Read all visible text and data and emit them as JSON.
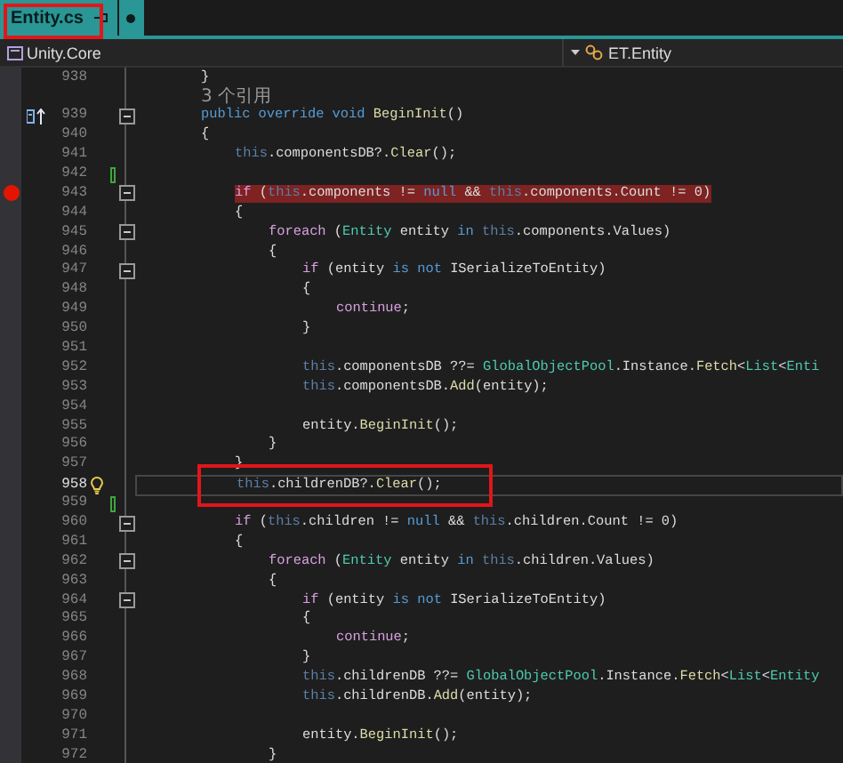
{
  "tab": {
    "title": "Entity.cs",
    "selected": true,
    "outlined": true,
    "modified": true
  },
  "nav": {
    "project": "Unity.Core",
    "member": "ET.Entity"
  },
  "lines": [
    {
      "kind": "code",
      "number": "938",
      "segments": [
        {
          "kind": "plain",
          "text": "}"
        }
      ]
    },
    {
      "kind": "codelens",
      "text": "3 个引用"
    },
    {
      "kind": "code",
      "number": "939",
      "override_marker": true,
      "expanded": true,
      "segments": [
        {
          "kind": "keyword",
          "text": "public override void "
        },
        {
          "kind": "method",
          "text": "BeginInit"
        },
        {
          "kind": "plain",
          "text": "()"
        }
      ]
    },
    {
      "kind": "code",
      "number": "940",
      "segments": [
        {
          "kind": "plain",
          "text": "{"
        }
      ],
      "children": [
        {
          "kind": "code",
          "number": "941",
          "segments": [
            {
              "kind": "faded",
              "text": "this"
            },
            {
              "kind": "plain",
              "text": ".componentsDB?."
            },
            {
              "kind": "method",
              "text": "Clear"
            },
            {
              "kind": "plain",
              "text": "();"
            }
          ]
        },
        {
          "kind": "code",
          "number": "942",
          "changed": true
        },
        {
          "kind": "code",
          "number": "943",
          "breakpoint": true,
          "expanded": true,
          "segments": [
            {
              "kind": "control",
              "text": "if"
            },
            {
              "kind": "plain",
              "text": " ("
            },
            {
              "kind": "faded",
              "text": "this"
            },
            {
              "kind": "plain",
              "text": ".components != "
            },
            {
              "kind": "keyword",
              "text": "null"
            },
            {
              "kind": "plain",
              "text": " && "
            },
            {
              "kind": "faded",
              "text": "this"
            },
            {
              "kind": "plain",
              "text": ".components.Count != 0)"
            }
          ]
        },
        {
          "kind": "code",
          "number": "944",
          "segments": [
            {
              "kind": "plain",
              "text": "{"
            }
          ],
          "children": [
            {
              "kind": "code",
              "number": "945",
              "expanded": true,
              "segments": [
                {
                  "kind": "control",
                  "text": "foreach"
                },
                {
                  "kind": "plain",
                  "text": " ("
                },
                {
                  "kind": "type",
                  "text": "Entity"
                },
                {
                  "kind": "plain",
                  "text": " entity "
                },
                {
                  "kind": "keyword",
                  "text": "in "
                },
                {
                  "kind": "faded",
                  "text": "this"
                },
                {
                  "kind": "plain",
                  "text": ".components.Values)"
                }
              ]
            },
            {
              "kind": "code",
              "number": "946",
              "segments": [
                {
                  "kind": "plain",
                  "text": "{"
                }
              ],
              "children": [
                {
                  "kind": "code",
                  "number": "947",
                  "expanded": true,
                  "segments": [
                    {
                      "kind": "control",
                      "text": "if"
                    },
                    {
                      "kind": "plain",
                      "text": " (entity "
                    },
                    {
                      "kind": "keyword",
                      "text": "is not"
                    },
                    {
                      "kind": "plain",
                      "text": " ISerializeToEntity)"
                    }
                  ]
                },
                {
                  "kind": "code",
                  "number": "948",
                  "segments": [
                    {
                      "kind": "plain",
                      "text": "{"
                    }
                  ],
                  "children": [
                    {
                      "kind": "code",
                      "number": "949",
                      "segments": [
                        {
                          "kind": "control",
                          "text": "continue"
                        },
                        {
                          "kind": "plain",
                          "text": ";"
                        }
                      ]
                    }
                  ]
                },
                {
                  "kind": "code",
                  "number": "950",
                  "segments": [
                    {
                      "kind": "plain",
                      "text": "}"
                    }
                  ]
                },
                {
                  "kind": "code",
                  "number": "951"
                },
                {
                  "kind": "code",
                  "number": "952",
                  "segments": [
                    {
                      "kind": "faded",
                      "text": "this"
                    },
                    {
                      "kind": "plain",
                      "text": ".componentsDB ??= "
                    },
                    {
                      "kind": "type",
                      "text": "GlobalObjectPool"
                    },
                    {
                      "kind": "plain",
                      "text": ".Instance."
                    },
                    {
                      "kind": "method",
                      "text": "Fetch"
                    },
                    {
                      "kind": "plain",
                      "text": "<"
                    },
                    {
                      "kind": "type",
                      "text": "List"
                    },
                    {
                      "kind": "plain",
                      "text": "<"
                    },
                    {
                      "kind": "type",
                      "text": "Enti"
                    }
                  ]
                },
                {
                  "kind": "code",
                  "number": "953",
                  "segments": [
                    {
                      "kind": "faded",
                      "text": "this"
                    },
                    {
                      "kind": "plain",
                      "text": ".componentsDB."
                    },
                    {
                      "kind": "method",
                      "text": "Add"
                    },
                    {
                      "kind": "plain",
                      "text": "(entity);"
                    }
                  ]
                },
                {
                  "kind": "code",
                  "number": "954"
                },
                {
                  "kind": "code",
                  "number": "955",
                  "segments": [
                    {
                      "kind": "plain",
                      "text": "entity."
                    },
                    {
                      "kind": "method",
                      "text": "BeginInit"
                    },
                    {
                      "kind": "plain",
                      "text": "();"
                    }
                  ]
                }
              ]
            },
            {
              "kind": "code",
              "number": "956",
              "segments": [
                {
                  "kind": "plain",
                  "text": "}"
                }
              ]
            }
          ]
        },
        {
          "kind": "code",
          "number": "957",
          "segments": [
            {
              "kind": "plain",
              "text": "}"
            }
          ]
        },
        {
          "kind": "code",
          "number": "958",
          "current": true,
          "lightbulb": true,
          "outlined": true,
          "segments": [
            {
              "kind": "faded",
              "text": "this"
            },
            {
              "kind": "plain",
              "text": ".childrenDB?."
            },
            {
              "kind": "method",
              "text": "Clear"
            },
            {
              "kind": "plain",
              "text": "();"
            }
          ]
        },
        {
          "kind": "code",
          "number": "959",
          "changed": true
        },
        {
          "kind": "code",
          "number": "960",
          "expanded": true,
          "segments": [
            {
              "kind": "control",
              "text": "if"
            },
            {
              "kind": "plain",
              "text": " ("
            },
            {
              "kind": "faded",
              "text": "this"
            },
            {
              "kind": "plain",
              "text": ".children != "
            },
            {
              "kind": "keyword",
              "text": "null"
            },
            {
              "kind": "plain",
              "text": " && "
            },
            {
              "kind": "faded",
              "text": "this"
            },
            {
              "kind": "plain",
              "text": ".children.Count != 0)"
            }
          ]
        },
        {
          "kind": "code",
          "number": "961",
          "segments": [
            {
              "kind": "plain",
              "text": "{"
            }
          ],
          "children": [
            {
              "kind": "code",
              "number": "962",
              "expanded": true,
              "segments": [
                {
                  "kind": "control",
                  "text": "foreach"
                },
                {
                  "kind": "plain",
                  "text": " ("
                },
                {
                  "kind": "type",
                  "text": "Entity"
                },
                {
                  "kind": "plain",
                  "text": " entity "
                },
                {
                  "kind": "keyword",
                  "text": "in "
                },
                {
                  "kind": "faded",
                  "text": "this"
                },
                {
                  "kind": "plain",
                  "text": ".children.Values)"
                }
              ]
            },
            {
              "kind": "code",
              "number": "963",
              "segments": [
                {
                  "kind": "plain",
                  "text": "{"
                }
              ],
              "children": [
                {
                  "kind": "code",
                  "number": "964",
                  "expanded": true,
                  "segments": [
                    {
                      "kind": "control",
                      "text": "if"
                    },
                    {
                      "kind": "plain",
                      "text": " (entity "
                    },
                    {
                      "kind": "keyword",
                      "text": "is not"
                    },
                    {
                      "kind": "plain",
                      "text": " ISerializeToEntity)"
                    }
                  ]
                },
                {
                  "kind": "code",
                  "number": "965",
                  "segments": [
                    {
                      "kind": "plain",
                      "text": "{"
                    }
                  ],
                  "children": [
                    {
                      "kind": "code",
                      "number": "966",
                      "segments": [
                        {
                          "kind": "control",
                          "text": "continue"
                        },
                        {
                          "kind": "plain",
                          "text": ";"
                        }
                      ]
                    }
                  ]
                },
                {
                  "kind": "code",
                  "number": "967",
                  "segments": [
                    {
                      "kind": "plain",
                      "text": "}"
                    }
                  ]
                },
                {
                  "kind": "code",
                  "number": "968",
                  "segments": [
                    {
                      "kind": "faded",
                      "text": "this"
                    },
                    {
                      "kind": "plain",
                      "text": ".childrenDB ??= "
                    },
                    {
                      "kind": "type",
                      "text": "GlobalObjectPool"
                    },
                    {
                      "kind": "plain",
                      "text": ".Instance."
                    },
                    {
                      "kind": "method",
                      "text": "Fetch"
                    },
                    {
                      "kind": "plain",
                      "text": "<"
                    },
                    {
                      "kind": "type",
                      "text": "List"
                    },
                    {
                      "kind": "plain",
                      "text": "<"
                    },
                    {
                      "kind": "type",
                      "text": "Entity"
                    }
                  ]
                },
                {
                  "kind": "code",
                  "number": "969",
                  "segments": [
                    {
                      "kind": "faded",
                      "text": "this"
                    },
                    {
                      "kind": "plain",
                      "text": ".childrenDB."
                    },
                    {
                      "kind": "method",
                      "text": "Add"
                    },
                    {
                      "kind": "plain",
                      "text": "(entity);"
                    }
                  ]
                },
                {
                  "kind": "code",
                  "number": "970"
                },
                {
                  "kind": "code",
                  "number": "971",
                  "segments": [
                    {
                      "kind": "plain",
                      "text": "entity."
                    },
                    {
                      "kind": "method",
                      "text": "BeginInit"
                    },
                    {
                      "kind": "plain",
                      "text": "();"
                    }
                  ]
                }
              ]
            },
            {
              "kind": "code",
              "number": "972",
              "segments": [
                {
                  "kind": "plain",
                  "text": "}"
                }
              ]
            }
          ]
        }
      ]
    }
  ]
}
